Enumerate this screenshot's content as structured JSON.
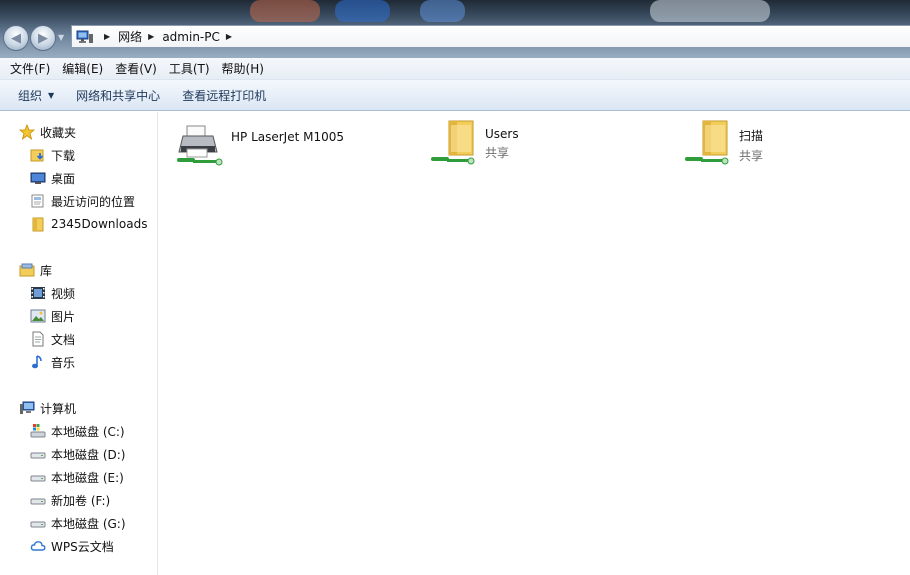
{
  "address": {
    "segments": [
      "网络",
      "admin-PC"
    ]
  },
  "menubar": {
    "items": [
      "文件(F)",
      "编辑(E)",
      "查看(V)",
      "工具(T)",
      "帮助(H)"
    ]
  },
  "commandbar": {
    "organize": "组织",
    "network_center": "网络和共享中心",
    "remote_printers": "查看远程打印机"
  },
  "navpane": {
    "favorites": {
      "header": "收藏夹",
      "items": [
        "下载",
        "桌面",
        "最近访问的位置",
        "2345Downloads"
      ]
    },
    "libraries": {
      "header": "库",
      "items": [
        "视频",
        "图片",
        "文档",
        "音乐"
      ]
    },
    "computer": {
      "header": "计算机",
      "items": [
        "本地磁盘 (C:)",
        "本地磁盘 (D:)",
        "本地磁盘 (E:)",
        "新加卷 (F:)",
        "本地磁盘 (G:)",
        "WPS云文档"
      ]
    }
  },
  "content": {
    "items": [
      {
        "name": "HP LaserJet M1005",
        "subtitle": "",
        "type": "printer"
      },
      {
        "name": "Users",
        "subtitle": "共享",
        "type": "shared-folder"
      },
      {
        "name": "扫描",
        "subtitle": "共享",
        "type": "shared-folder"
      }
    ]
  },
  "colors": {
    "command_text": "#1e395b",
    "subtitle_text": "#6d6d6d",
    "folder_yellow": "#f3cd5a",
    "share_green": "#2f9e3a"
  }
}
